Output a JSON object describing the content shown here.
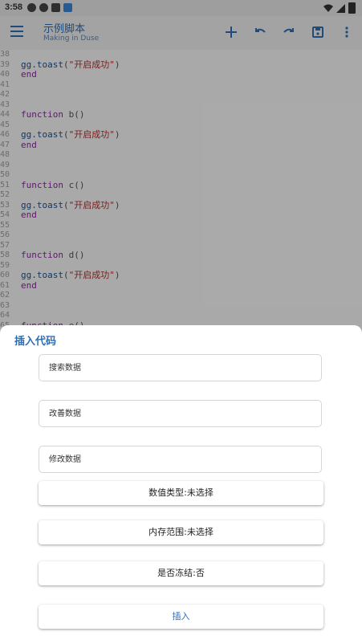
{
  "status_bar": {
    "time": "3:58"
  },
  "app_bar": {
    "title": "示例脚本",
    "subtitle": "Making in Duse"
  },
  "code_lines": [
    {
      "n": "38",
      "parts": []
    },
    {
      "n": "39",
      "parts": [
        {
          "c": "fn",
          "t": "gg.toast"
        },
        {
          "c": "pl",
          "t": "("
        },
        {
          "c": "str",
          "t": "\"开启成功\""
        },
        {
          "c": "pl",
          "t": ")"
        }
      ]
    },
    {
      "n": "40",
      "parts": [
        {
          "c": "kw",
          "t": "end"
        }
      ]
    },
    {
      "n": "41",
      "parts": []
    },
    {
      "n": "42",
      "parts": []
    },
    {
      "n": "43",
      "parts": []
    },
    {
      "n": "44",
      "parts": [
        {
          "c": "kw",
          "t": "function"
        },
        {
          "c": "pl",
          "t": " b()"
        }
      ]
    },
    {
      "n": "45",
      "parts": []
    },
    {
      "n": "46",
      "parts": [
        {
          "c": "fn",
          "t": "gg.toast"
        },
        {
          "c": "pl",
          "t": "("
        },
        {
          "c": "str",
          "t": "\"开启成功\""
        },
        {
          "c": "pl",
          "t": ")"
        }
      ]
    },
    {
      "n": "47",
      "parts": [
        {
          "c": "kw",
          "t": "end"
        }
      ]
    },
    {
      "n": "48",
      "parts": []
    },
    {
      "n": "49",
      "parts": []
    },
    {
      "n": "50",
      "parts": []
    },
    {
      "n": "51",
      "parts": [
        {
          "c": "kw",
          "t": "function"
        },
        {
          "c": "pl",
          "t": " c()"
        }
      ]
    },
    {
      "n": "52",
      "parts": []
    },
    {
      "n": "53",
      "parts": [
        {
          "c": "fn",
          "t": "gg.toast"
        },
        {
          "c": "pl",
          "t": "("
        },
        {
          "c": "str",
          "t": "\"开启成功\""
        },
        {
          "c": "pl",
          "t": ")"
        }
      ]
    },
    {
      "n": "54",
      "parts": [
        {
          "c": "kw",
          "t": "end"
        }
      ]
    },
    {
      "n": "55",
      "parts": []
    },
    {
      "n": "56",
      "parts": []
    },
    {
      "n": "57",
      "parts": []
    },
    {
      "n": "58",
      "parts": [
        {
          "c": "kw",
          "t": "function"
        },
        {
          "c": "pl",
          "t": " d()"
        }
      ]
    },
    {
      "n": "59",
      "parts": []
    },
    {
      "n": "60",
      "parts": [
        {
          "c": "fn",
          "t": "gg.toast"
        },
        {
          "c": "pl",
          "t": "("
        },
        {
          "c": "str",
          "t": "\"开启成功\""
        },
        {
          "c": "pl",
          "t": ")"
        }
      ]
    },
    {
      "n": "61",
      "parts": [
        {
          "c": "kw",
          "t": "end"
        }
      ]
    },
    {
      "n": "62",
      "parts": []
    },
    {
      "n": "63",
      "parts": []
    },
    {
      "n": "64",
      "parts": []
    },
    {
      "n": "65",
      "parts": [
        {
          "c": "kw",
          "t": "function"
        },
        {
          "c": "pl",
          "t": " e()"
        }
      ]
    }
  ],
  "sheet": {
    "title": "插入代码",
    "search_field": "搜索数据",
    "improve_field": "改善数据",
    "modify_field": "修改数据",
    "value_type_button": "数值类型:未选择",
    "memory_range_button": "内存范围:未选择",
    "freeze_button": "是否冻结:否",
    "insert_button": "插入"
  },
  "colors": {
    "accent": "#2d6fb5",
    "keyword": "#8a2aa0",
    "string": "#b03030"
  }
}
